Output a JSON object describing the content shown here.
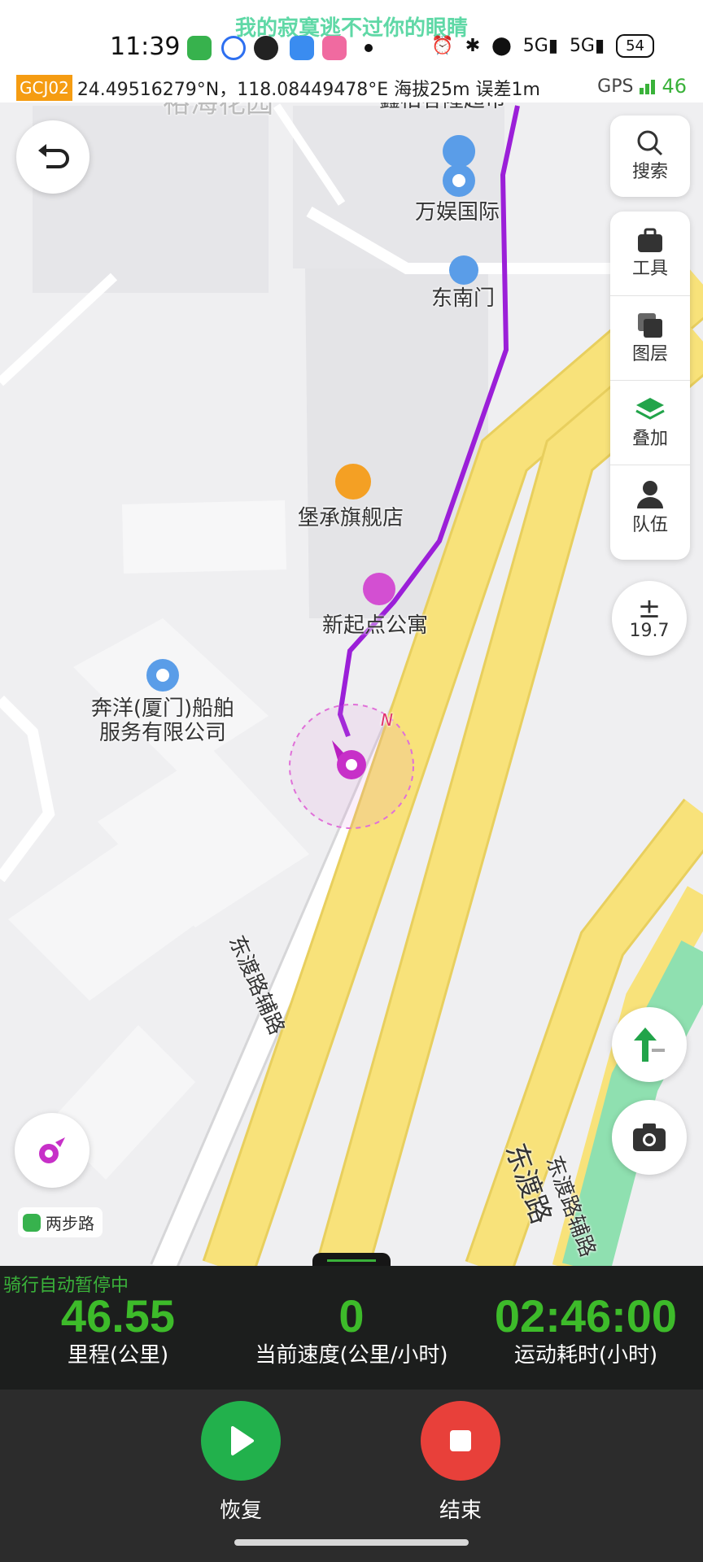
{
  "status_bar": {
    "song_lyric": "我的寂寞逃不过你的眼睛",
    "time": "11:39",
    "battery": "54"
  },
  "gps_info": {
    "coord_system": "GCJ02",
    "coordinates": "24.49516279°N，118.08449478°E 海拔25m 误差1m",
    "gps_label": "GPS",
    "gps_count": "46"
  },
  "map": {
    "labels": {
      "top_left": "裕海花园",
      "top_center": "鑫柏客隆超市",
      "poi_1": "万娱国际",
      "poi_2": "东南门",
      "poi_3": "堡承旗舰店",
      "poi_4": "新起点公寓",
      "poi_5": "奔洋(厦门)船舶服务有限公司",
      "road_1": "东渡路辅路",
      "road_2": "东渡路",
      "road_3": "东渡路辅路"
    },
    "compass_north": "N",
    "brand": "两步路",
    "colors": {
      "track": "#9b1fd8",
      "road": "#f8e27a",
      "park": "#8fe0b0"
    }
  },
  "side_panel": {
    "search": "搜索",
    "tools": "工具",
    "layers": "图层",
    "overlay": "叠加",
    "team": "队伍"
  },
  "zoom": {
    "level": "19.7"
  },
  "stats": {
    "auto_pause": "骑行自动暂停中",
    "distance_value": "46.55",
    "distance_label": "里程(公里)",
    "speed_value": "0",
    "speed_label": "当前速度(公里/小时)",
    "duration_value": "02:46:00",
    "duration_label": "运动耗时(小时)"
  },
  "controls": {
    "resume": "恢复",
    "end": "结束",
    "resume_color": "#22b14c",
    "end_color": "#e8403a"
  }
}
